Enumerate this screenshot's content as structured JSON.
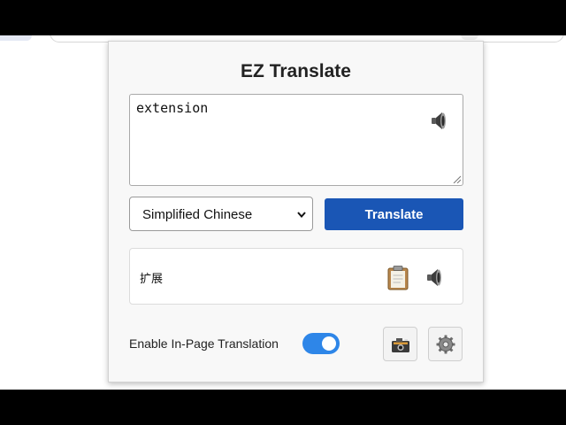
{
  "popup": {
    "title": "EZ Translate"
  },
  "source": {
    "value": "extension",
    "speaker_icon": "speaker-icon"
  },
  "language_select": {
    "selected": "Simplified Chinese",
    "icon": "chevron-down-icon"
  },
  "translate_button": {
    "label": "Translate"
  },
  "result": {
    "text": "扩展",
    "copy_icon": "clipboard-icon",
    "speaker_icon": "speaker-icon"
  },
  "in_page_translation": {
    "label": "Enable In-Page Translation",
    "enabled": true
  },
  "toolbar": {
    "screenshot_icon": "camera-icon",
    "settings_icon": "gear-icon"
  },
  "colors": {
    "primary": "#1a56b5",
    "toggle_on": "#2e86e8",
    "panel_bg": "#f8f8f8"
  }
}
